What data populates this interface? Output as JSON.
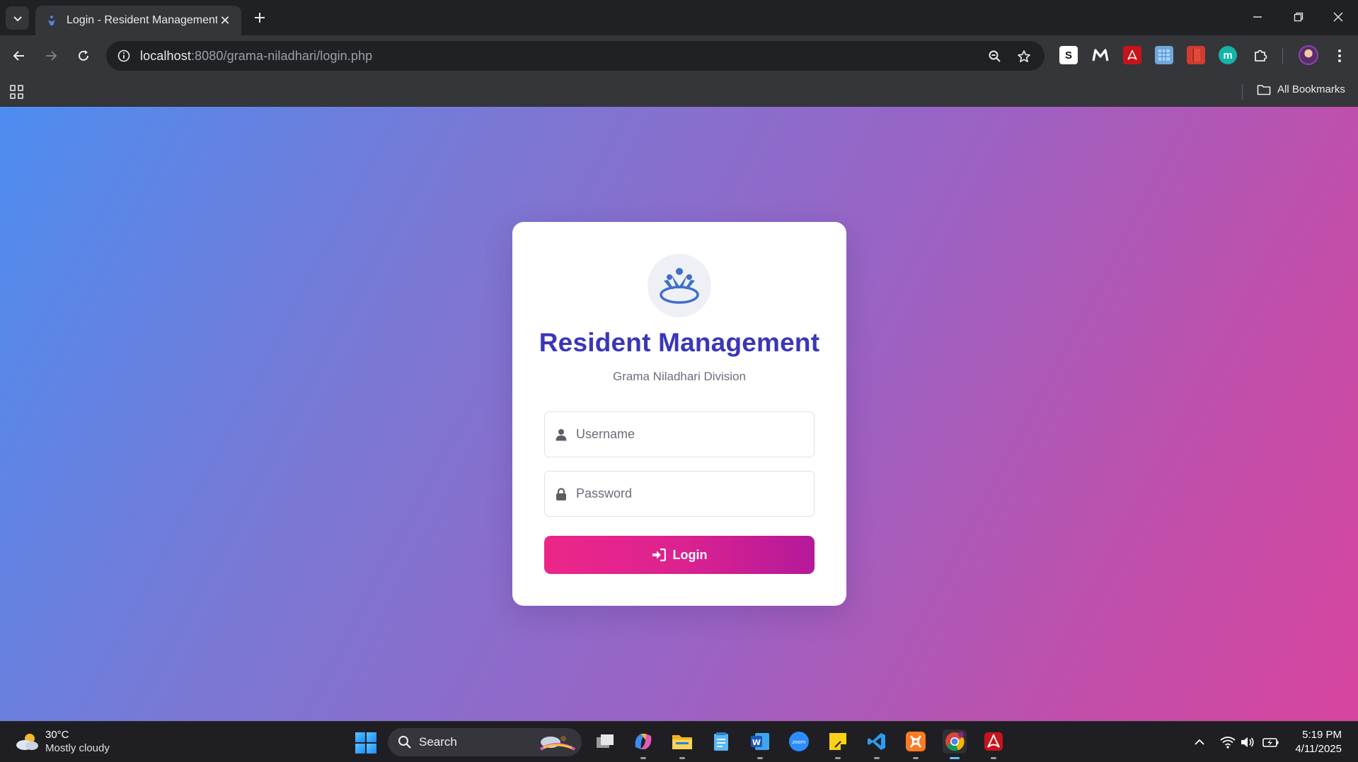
{
  "browser": {
    "tab": {
      "title": "Login - Resident Management"
    },
    "address_bar": {
      "host": "localhost",
      "rest": ":8080/grama-niladhari/login.php"
    },
    "bookmarks": {
      "all_label": "All Bookmarks"
    },
    "extensions": [
      "slack-icon",
      "m-logo-icon",
      "acrobat-icon",
      "grid-extension-icon",
      "book-icon",
      "m-circle-icon",
      "puzzle-icon"
    ]
  },
  "login": {
    "title": "Resident Management",
    "subtitle": "Grama Niladhari Division",
    "username_placeholder": "Username",
    "password_placeholder": "Password",
    "button_label": "Login",
    "accent_color": "#3a36b9",
    "button_color": "#e3238c"
  },
  "taskbar": {
    "weather": {
      "temp": "30°C",
      "desc": "Mostly cloudy"
    },
    "search_label": "Search",
    "time": "5:19 PM",
    "date": "4/11/2025"
  }
}
